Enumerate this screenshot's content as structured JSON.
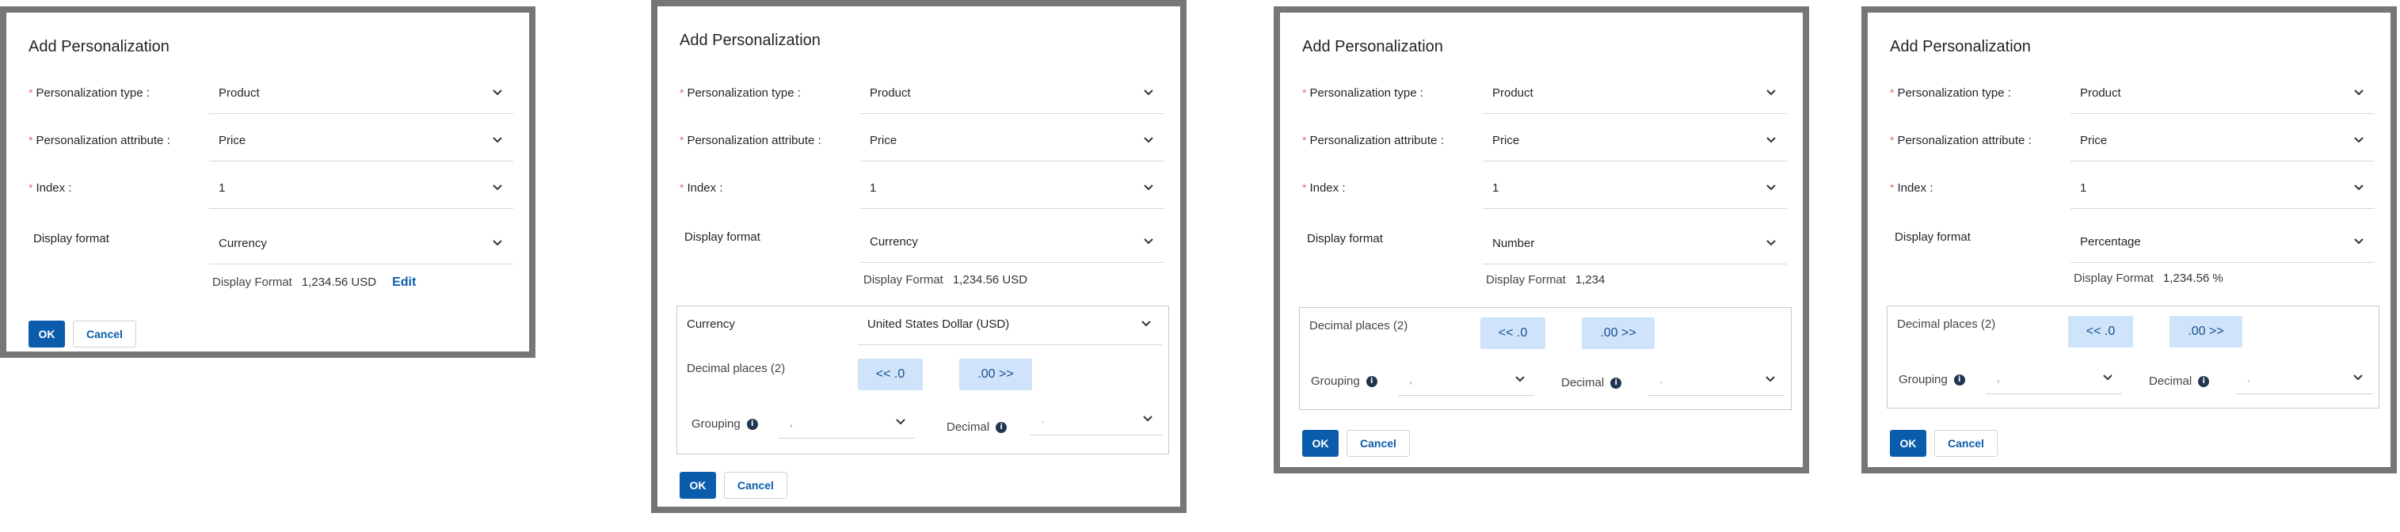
{
  "dialog": {
    "title": "Add Personalization",
    "labels": {
      "type": "Personalization type",
      "attribute": "Personalization attribute",
      "index": "Index",
      "display_format": "Display format",
      "display_format_preview": "Display Format",
      "currency": "Currency",
      "decimal_places": "Decimal places (2)",
      "grouping": "Grouping",
      "decimal": "Decimal"
    },
    "values": {
      "type": "Product",
      "attribute": "Price",
      "index": "1"
    },
    "colon": ":",
    "required_mark": "*",
    "ok_label": "OK",
    "cancel_label": "Cancel",
    "edit_label": "Edit",
    "decrease_label": "<< .0",
    "increase_label": ".00 >>",
    "info_glyph": "i",
    "separator_placeholder": ",",
    "decimal_placeholder": "."
  },
  "variants": [
    {
      "format": "Currency",
      "preview": "1,234.56 USD",
      "has_edit": true
    },
    {
      "format": "Currency",
      "preview": "1,234.56 USD",
      "currency_value": "United States Dollar (USD)"
    },
    {
      "format": "Number",
      "preview": "1,234"
    },
    {
      "format": "Percentage",
      "preview": "1,234.56 %"
    }
  ],
  "colors": {
    "primary": "#0b5cab",
    "decimal_button_bg": "#cfe4fb",
    "required": "#e26a6a",
    "frame": "#767676"
  },
  "icons": [
    "chevron-down-icon",
    "info-icon"
  ]
}
